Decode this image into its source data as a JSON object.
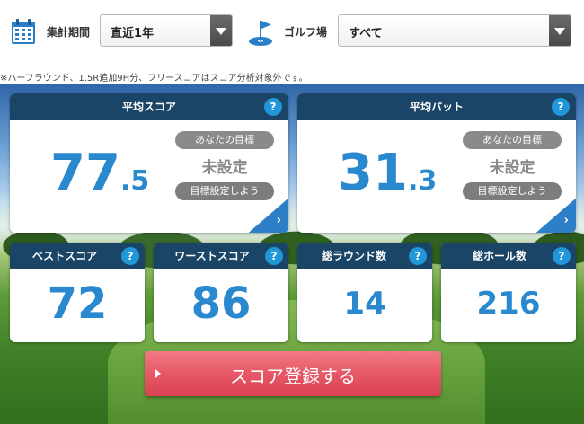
{
  "filters": {
    "period": {
      "label": "集計期間",
      "value": "直近1年",
      "icon": "calendar-icon"
    },
    "course": {
      "label": "ゴルフ場",
      "value": "すべて",
      "icon": "golf-flag-icon"
    }
  },
  "note": "※ハーフラウンド、1.5R追加9H分、フリースコアはスコア分析対象外です。",
  "help_glyph": "?",
  "average_score": {
    "title": "平均スコア",
    "value_int": "77",
    "value_dec": ".5",
    "goal_label": "あなたの目標",
    "goal_value": "未設定",
    "goal_button": "目標設定しよう",
    "chevron": "›"
  },
  "average_putt": {
    "title": "平均パット",
    "value_int": "31",
    "value_dec": ".3",
    "goal_label": "あなたの目標",
    "goal_value": "未設定",
    "goal_button": "目標設定しよう",
    "chevron": "›"
  },
  "stats": [
    {
      "title": "ベストスコア",
      "value": "72"
    },
    {
      "title": "ワーストスコア",
      "value": "86"
    },
    {
      "title": "総ラウンド数",
      "value": "14"
    },
    {
      "title": "総ホール数",
      "value": "216"
    }
  ],
  "register_button": {
    "label": "スコア登録する"
  },
  "colors": {
    "header": "#1a4566",
    "accent": "#2a88cf",
    "help": "#2196d8",
    "register": "#e65866",
    "pill": "#8a8a8a"
  }
}
